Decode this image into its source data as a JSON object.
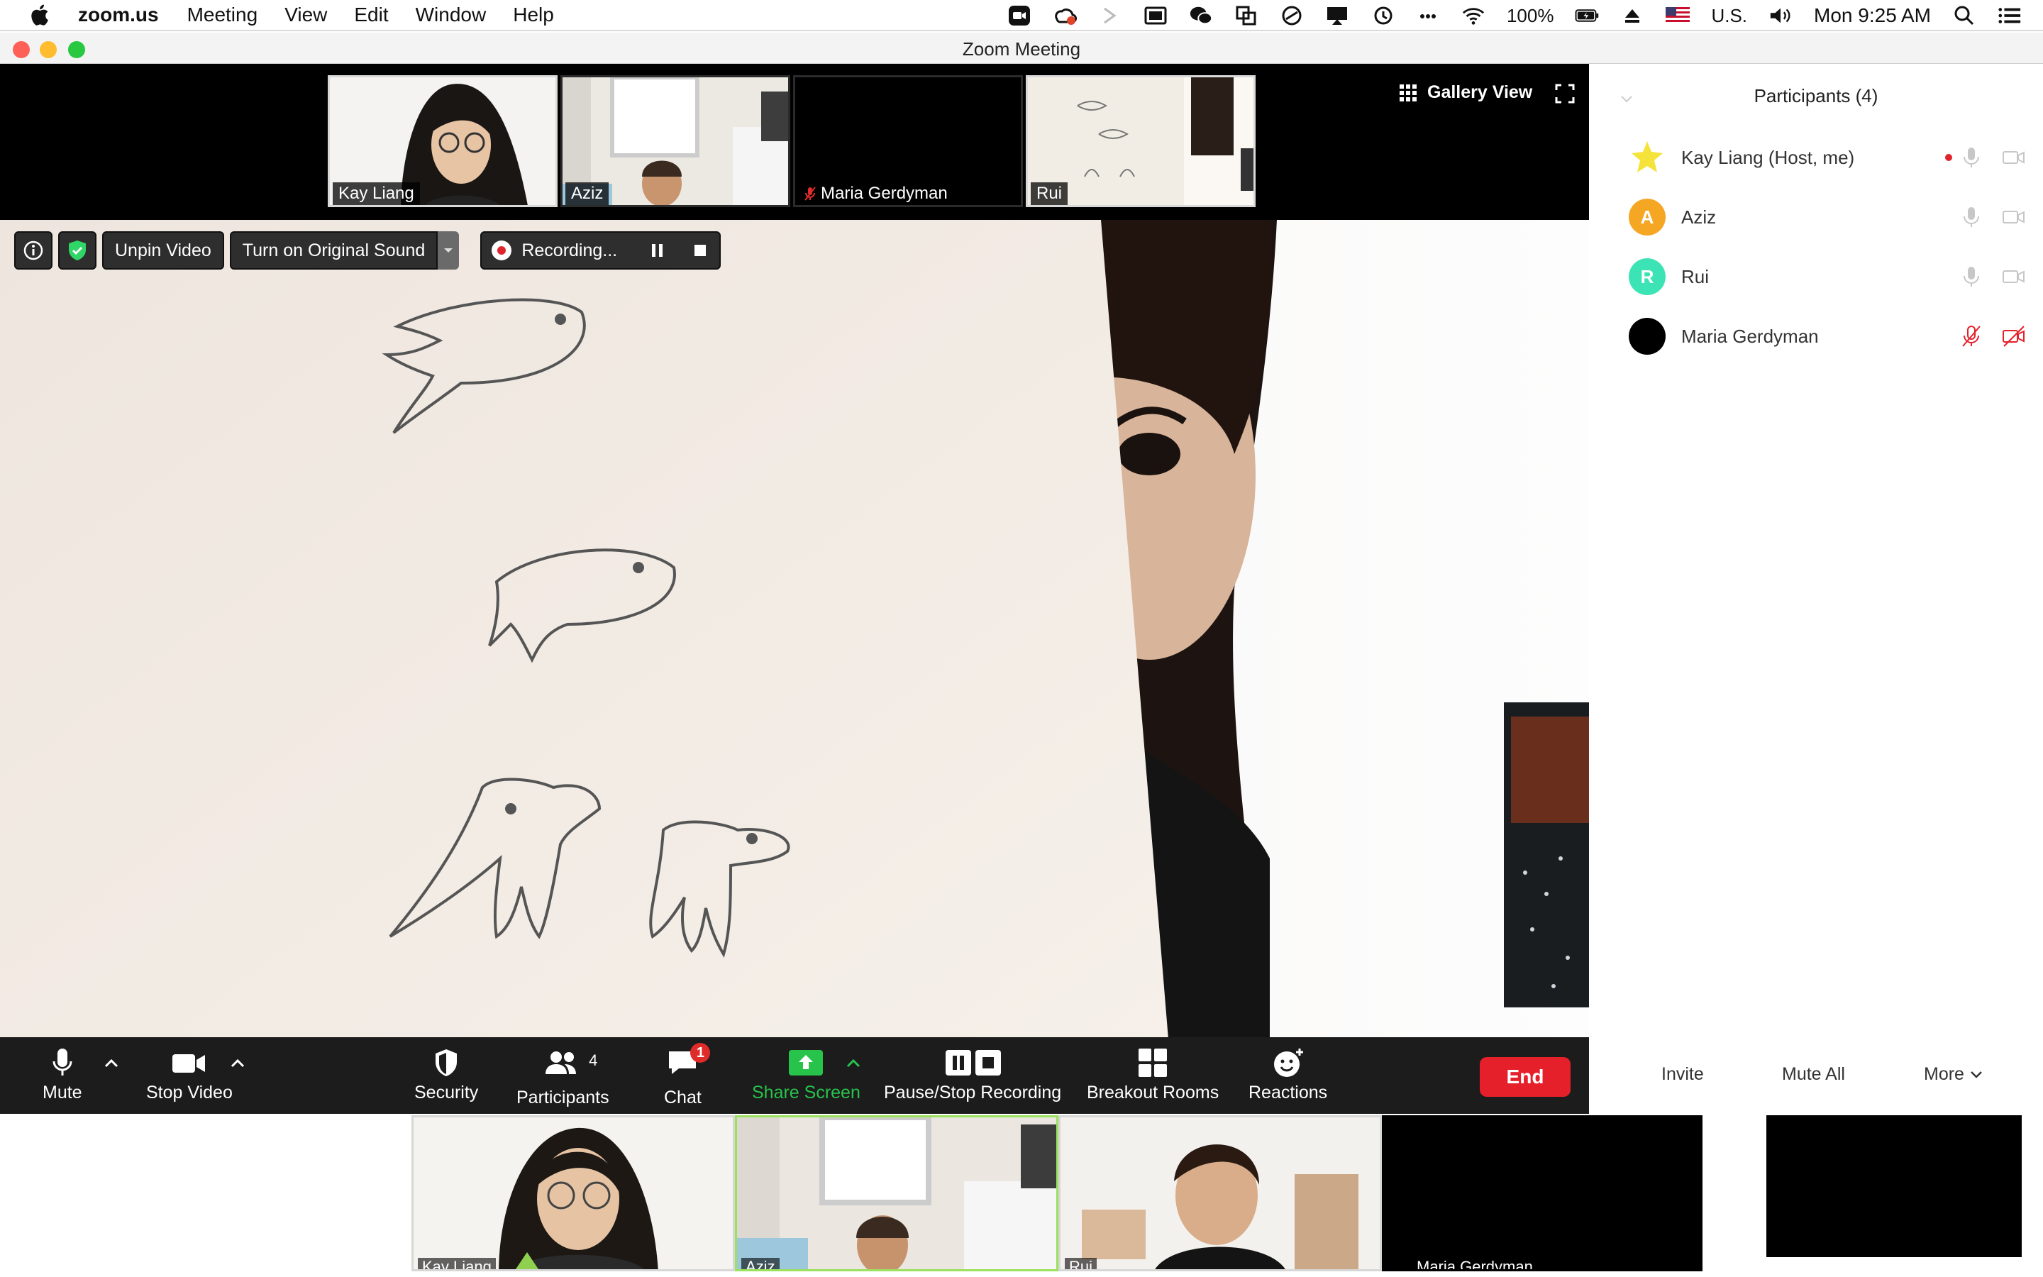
{
  "menubar": {
    "app_name": "zoom.us",
    "items": [
      "Meeting",
      "View",
      "Edit",
      "Window",
      "Help"
    ],
    "battery": "100%",
    "input_source": "U.S.",
    "clock": "Mon 9:25 AM"
  },
  "window": {
    "title": "Zoom Meeting"
  },
  "filmstrip": {
    "tiles": [
      {
        "name": "Kay Liang",
        "muted": false
      },
      {
        "name": "Aziz",
        "muted": false
      },
      {
        "name": "Maria Gerdyman",
        "muted": true
      },
      {
        "name": "Rui",
        "muted": false
      }
    ],
    "gallery_label": "Gallery View"
  },
  "overlay": {
    "unpin_label": "Unpin Video",
    "original_sound_label": "Turn on Original Sound",
    "recording_label": "Recording..."
  },
  "toolbar": {
    "mute_label": "Mute",
    "stop_video_label": "Stop Video",
    "security_label": "Security",
    "participants_label": "Participants",
    "participants_count": "4",
    "chat_label": "Chat",
    "chat_badge": "1",
    "share_label": "Share Screen",
    "recording_label": "Pause/Stop Recording",
    "breakout_label": "Breakout Rooms",
    "reactions_label": "Reactions",
    "end_label": "End"
  },
  "participants_panel": {
    "title": "Participants (4)",
    "people": [
      {
        "name": "Kay Liang (Host, me)",
        "initial": "",
        "color": "#f5e23a"
      },
      {
        "name": "Aziz",
        "initial": "A",
        "color": "#f5a623"
      },
      {
        "name": "Rui",
        "initial": "R",
        "color": "#3ce3b4"
      },
      {
        "name": "Maria Gerdyman",
        "initial": "",
        "color": "#000000"
      }
    ],
    "invite_label": "Invite",
    "mute_all_label": "Mute All",
    "more_label": "More"
  },
  "gallery_bottom": {
    "tiles": [
      "Kay Liang",
      "Aziz",
      "Rui",
      "Maria Gerdyman"
    ]
  },
  "colors": {
    "end_red": "#e5202b",
    "share_green": "#27c34b",
    "toolbar_bg": "#1c1c1c"
  }
}
